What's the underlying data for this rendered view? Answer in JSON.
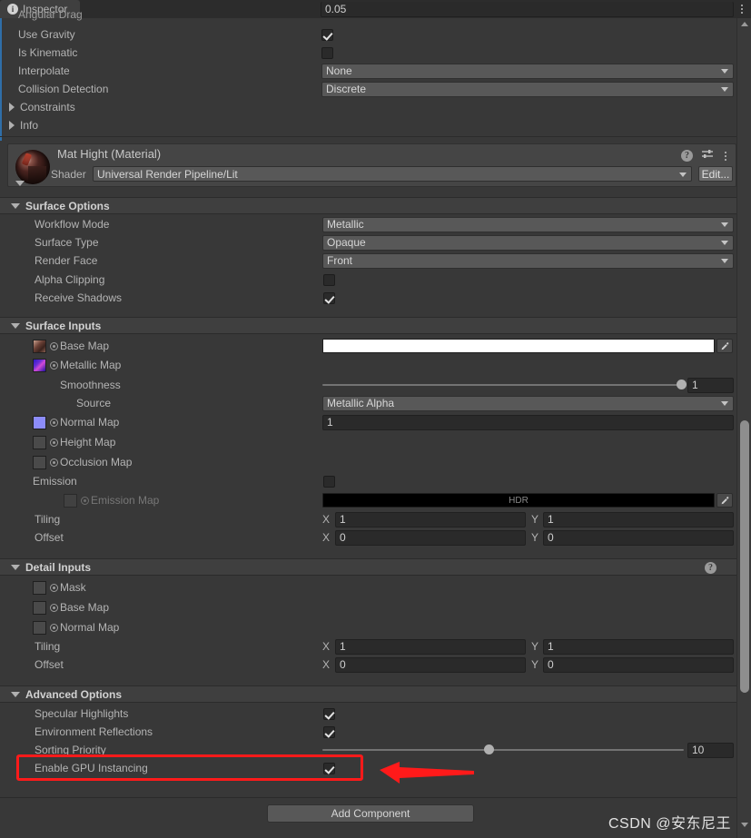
{
  "window": {
    "tab_label": "Inspector",
    "tab_icon": "info-icon",
    "lock_icon": "padlock-open-icon",
    "menu_icon": "kebab-menu-icon"
  },
  "rigidbody": {
    "clipped_row_label": "Angular Drag",
    "clipped_row_value": "0.05",
    "rows": [
      {
        "label": "Use Gravity",
        "type": "checkbox",
        "value": true
      },
      {
        "label": "Is Kinematic",
        "type": "checkbox",
        "value": false
      },
      {
        "label": "Interpolate",
        "type": "dropdown",
        "value": "None"
      },
      {
        "label": "Collision Detection",
        "type": "dropdown",
        "value": "Discrete"
      }
    ],
    "foldouts": [
      {
        "label": "Constraints",
        "expanded": false
      },
      {
        "label": "Info",
        "expanded": false
      }
    ]
  },
  "material": {
    "title": "Mat Hight (Material)",
    "shader_label": "Shader",
    "shader_value": "Universal Render Pipeline/Lit",
    "edit_button": "Edit...",
    "help_icon": "help-icon",
    "preset_icon": "preset-sliders-icon",
    "menu_icon": "kebab-menu-icon",
    "preview_icon": "material-sphere-preview"
  },
  "surface_options": {
    "header": "Surface Options",
    "rows": [
      {
        "label": "Workflow Mode",
        "type": "dropdown",
        "value": "Metallic"
      },
      {
        "label": "Surface Type",
        "type": "dropdown",
        "value": "Opaque"
      },
      {
        "label": "Render Face",
        "type": "dropdown",
        "value": "Front"
      },
      {
        "label": "Alpha Clipping",
        "type": "checkbox",
        "value": false
      },
      {
        "label": "Receive Shadows",
        "type": "checkbox",
        "value": true
      }
    ]
  },
  "surface_inputs": {
    "header": "Surface Inputs",
    "base_map": {
      "label": "Base Map",
      "color": "#ffffff",
      "has_texture": true
    },
    "metallic_map": {
      "label": "Metallic Map",
      "has_texture": true
    },
    "smoothness": {
      "label": "Smoothness",
      "value": "1",
      "slider_pct": 100
    },
    "source": {
      "label": "Source",
      "value": "Metallic Alpha"
    },
    "normal_map": {
      "label": "Normal Map",
      "value": "1",
      "has_texture": true,
      "swatch": "#8c8cfa"
    },
    "height_map": {
      "label": "Height Map",
      "has_texture": false
    },
    "occlusion_map": {
      "label": "Occlusion Map",
      "has_texture": false
    },
    "emission": {
      "label": "Emission",
      "enabled": false
    },
    "emission_map": {
      "label": "Emission Map",
      "color": "#000000",
      "hdr_label": "HDR"
    },
    "tiling": {
      "label": "Tiling",
      "x_label": "X",
      "x": "1",
      "y_label": "Y",
      "y": "1"
    },
    "offset": {
      "label": "Offset",
      "x_label": "X",
      "x": "0",
      "y_label": "Y",
      "y": "0"
    }
  },
  "detail_inputs": {
    "header": "Detail Inputs",
    "help_icon": "help-icon",
    "mask": {
      "label": "Mask"
    },
    "base_map": {
      "label": "Base Map"
    },
    "normal_map": {
      "label": "Normal Map"
    },
    "tiling": {
      "label": "Tiling",
      "x_label": "X",
      "x": "1",
      "y_label": "Y",
      "y": "1"
    },
    "offset": {
      "label": "Offset",
      "x_label": "X",
      "x": "0",
      "y_label": "Y",
      "y": "0"
    }
  },
  "advanced_options": {
    "header": "Advanced Options",
    "specular_highlights": {
      "label": "Specular Highlights",
      "value": true
    },
    "environment_reflections": {
      "label": "Environment Reflections",
      "value": true
    },
    "sorting_priority": {
      "label": "Sorting Priority",
      "value": "10",
      "slider_pct": 46
    },
    "enable_gpu_instancing": {
      "label": "Enable GPU Instancing",
      "value": true,
      "highlighted": true
    }
  },
  "footer": {
    "add_component": "Add Component",
    "watermark": "CSDN @安东尼王"
  },
  "annotation": {
    "highlight_color": "#ff1a1a",
    "arrow_color": "#ff1a1a"
  }
}
